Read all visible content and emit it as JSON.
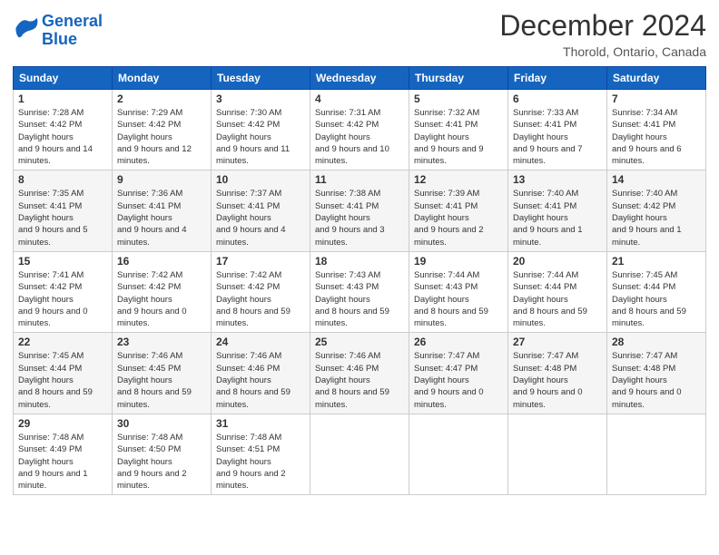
{
  "logo": {
    "line1": "General",
    "line2": "Blue"
  },
  "title": "December 2024",
  "subtitle": "Thorold, Ontario, Canada",
  "weekdays": [
    "Sunday",
    "Monday",
    "Tuesday",
    "Wednesday",
    "Thursday",
    "Friday",
    "Saturday"
  ],
  "weeks": [
    [
      {
        "day": "1",
        "sunrise": "7:28 AM",
        "sunset": "4:42 PM",
        "daylight": "9 hours and 14 minutes."
      },
      {
        "day": "2",
        "sunrise": "7:29 AM",
        "sunset": "4:42 PM",
        "daylight": "9 hours and 12 minutes."
      },
      {
        "day": "3",
        "sunrise": "7:30 AM",
        "sunset": "4:42 PM",
        "daylight": "9 hours and 11 minutes."
      },
      {
        "day": "4",
        "sunrise": "7:31 AM",
        "sunset": "4:42 PM",
        "daylight": "9 hours and 10 minutes."
      },
      {
        "day": "5",
        "sunrise": "7:32 AM",
        "sunset": "4:41 PM",
        "daylight": "9 hours and 9 minutes."
      },
      {
        "day": "6",
        "sunrise": "7:33 AM",
        "sunset": "4:41 PM",
        "daylight": "9 hours and 7 minutes."
      },
      {
        "day": "7",
        "sunrise": "7:34 AM",
        "sunset": "4:41 PM",
        "daylight": "9 hours and 6 minutes."
      }
    ],
    [
      {
        "day": "8",
        "sunrise": "7:35 AM",
        "sunset": "4:41 PM",
        "daylight": "9 hours and 5 minutes."
      },
      {
        "day": "9",
        "sunrise": "7:36 AM",
        "sunset": "4:41 PM",
        "daylight": "9 hours and 4 minutes."
      },
      {
        "day": "10",
        "sunrise": "7:37 AM",
        "sunset": "4:41 PM",
        "daylight": "9 hours and 4 minutes."
      },
      {
        "day": "11",
        "sunrise": "7:38 AM",
        "sunset": "4:41 PM",
        "daylight": "9 hours and 3 minutes."
      },
      {
        "day": "12",
        "sunrise": "7:39 AM",
        "sunset": "4:41 PM",
        "daylight": "9 hours and 2 minutes."
      },
      {
        "day": "13",
        "sunrise": "7:40 AM",
        "sunset": "4:41 PM",
        "daylight": "9 hours and 1 minute."
      },
      {
        "day": "14",
        "sunrise": "7:40 AM",
        "sunset": "4:42 PM",
        "daylight": "9 hours and 1 minute."
      }
    ],
    [
      {
        "day": "15",
        "sunrise": "7:41 AM",
        "sunset": "4:42 PM",
        "daylight": "9 hours and 0 minutes."
      },
      {
        "day": "16",
        "sunrise": "7:42 AM",
        "sunset": "4:42 PM",
        "daylight": "9 hours and 0 minutes."
      },
      {
        "day": "17",
        "sunrise": "7:42 AM",
        "sunset": "4:42 PM",
        "daylight": "8 hours and 59 minutes."
      },
      {
        "day": "18",
        "sunrise": "7:43 AM",
        "sunset": "4:43 PM",
        "daylight": "8 hours and 59 minutes."
      },
      {
        "day": "19",
        "sunrise": "7:44 AM",
        "sunset": "4:43 PM",
        "daylight": "8 hours and 59 minutes."
      },
      {
        "day": "20",
        "sunrise": "7:44 AM",
        "sunset": "4:44 PM",
        "daylight": "8 hours and 59 minutes."
      },
      {
        "day": "21",
        "sunrise": "7:45 AM",
        "sunset": "4:44 PM",
        "daylight": "8 hours and 59 minutes."
      }
    ],
    [
      {
        "day": "22",
        "sunrise": "7:45 AM",
        "sunset": "4:44 PM",
        "daylight": "8 hours and 59 minutes."
      },
      {
        "day": "23",
        "sunrise": "7:46 AM",
        "sunset": "4:45 PM",
        "daylight": "8 hours and 59 minutes."
      },
      {
        "day": "24",
        "sunrise": "7:46 AM",
        "sunset": "4:46 PM",
        "daylight": "8 hours and 59 minutes."
      },
      {
        "day": "25",
        "sunrise": "7:46 AM",
        "sunset": "4:46 PM",
        "daylight": "8 hours and 59 minutes."
      },
      {
        "day": "26",
        "sunrise": "7:47 AM",
        "sunset": "4:47 PM",
        "daylight": "9 hours and 0 minutes."
      },
      {
        "day": "27",
        "sunrise": "7:47 AM",
        "sunset": "4:48 PM",
        "daylight": "9 hours and 0 minutes."
      },
      {
        "day": "28",
        "sunrise": "7:47 AM",
        "sunset": "4:48 PM",
        "daylight": "9 hours and 0 minutes."
      }
    ],
    [
      {
        "day": "29",
        "sunrise": "7:48 AM",
        "sunset": "4:49 PM",
        "daylight": "9 hours and 1 minute."
      },
      {
        "day": "30",
        "sunrise": "7:48 AM",
        "sunset": "4:50 PM",
        "daylight": "9 hours and 2 minutes."
      },
      {
        "day": "31",
        "sunrise": "7:48 AM",
        "sunset": "4:51 PM",
        "daylight": "9 hours and 2 minutes."
      },
      null,
      null,
      null,
      null
    ]
  ],
  "labels": {
    "sunrise": "Sunrise:",
    "sunset": "Sunset:",
    "daylight": "Daylight:"
  }
}
